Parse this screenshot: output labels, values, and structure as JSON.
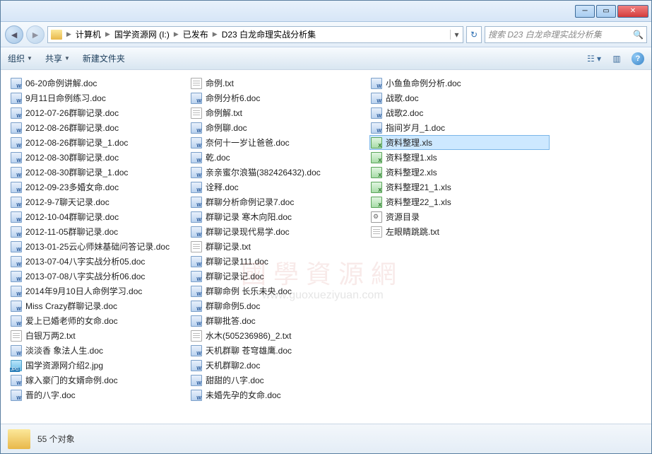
{
  "breadcrumbs": [
    "计算机",
    "国学资源网 (I:)",
    "已发布",
    "D23 白龙命理实战分析集"
  ],
  "search_placeholder": "搜索 D23 白龙命理实战分析集",
  "toolbar": {
    "organize": "组织",
    "share": "共享",
    "newfolder": "新建文件夹"
  },
  "columns": [
    [
      {
        "n": "06-20命例讲解.doc",
        "t": "doc"
      },
      {
        "n": "9月11日命例练习.doc",
        "t": "doc"
      },
      {
        "n": "2012-07-26群聊记录.doc",
        "t": "doc"
      },
      {
        "n": "2012-08-26群聊记录.doc",
        "t": "doc"
      },
      {
        "n": "2012-08-26群聊记录_1.doc",
        "t": "doc"
      },
      {
        "n": "2012-08-30群聊记录.doc",
        "t": "doc"
      },
      {
        "n": "2012-08-30群聊记录_1.doc",
        "t": "doc"
      },
      {
        "n": "2012-09-23多婚女命.doc",
        "t": "doc"
      },
      {
        "n": "2012-9-7聊天记录.doc",
        "t": "doc"
      },
      {
        "n": "2012-10-04群聊记录.doc",
        "t": "doc"
      },
      {
        "n": "2012-11-05群聊记录.doc",
        "t": "doc"
      },
      {
        "n": "2013-01-25云心师妹基础问答记录.doc",
        "t": "doc"
      },
      {
        "n": "2013-07-04八字实战分析05.doc",
        "t": "doc"
      },
      {
        "n": "2013-07-08八字实战分析06.doc",
        "t": "doc"
      },
      {
        "n": "2014年9月10日人命例学习.doc",
        "t": "doc"
      },
      {
        "n": "Miss Crazy群聊记录.doc",
        "t": "doc"
      },
      {
        "n": "爱上已婚老师的女命.doc",
        "t": "doc"
      },
      {
        "n": "白银万两2.txt",
        "t": "txt"
      },
      {
        "n": "淡淡香 象法人生.doc",
        "t": "doc"
      },
      {
        "n": "国学资源网介绍2.jpg",
        "t": "jpg"
      },
      {
        "n": "嫁入豪门的女婿命例.doc",
        "t": "doc"
      },
      {
        "n": "晋的八字.doc",
        "t": "doc"
      }
    ],
    [
      {
        "n": "命例.txt",
        "t": "txt"
      },
      {
        "n": "命例分析6.doc",
        "t": "doc"
      },
      {
        "n": "命例解.txt",
        "t": "txt"
      },
      {
        "n": "命例聊.doc",
        "t": "doc"
      },
      {
        "n": "奈何十一岁让爸爸.doc",
        "t": "doc"
      },
      {
        "n": "乾.doc",
        "t": "doc"
      },
      {
        "n": "亲亲蜜尔浪猫(382426432).doc",
        "t": "doc"
      },
      {
        "n": "诠释.doc",
        "t": "doc"
      },
      {
        "n": "群聊分析命例记录7.doc",
        "t": "doc"
      },
      {
        "n": "群聊记录 寒木向阳.doc",
        "t": "doc"
      },
      {
        "n": "群聊记录现代易学.doc",
        "t": "doc"
      },
      {
        "n": "群聊记录.txt",
        "t": "txt"
      },
      {
        "n": "群聊记录111.doc",
        "t": "doc"
      },
      {
        "n": "群聊记录记.doc",
        "t": "doc"
      },
      {
        "n": "群聊命例 长乐未央.doc",
        "t": "doc"
      },
      {
        "n": "群聊命例5.doc",
        "t": "doc"
      },
      {
        "n": "群聊批答.doc",
        "t": "doc"
      },
      {
        "n": "水木(505236986)_2.txt",
        "t": "txt"
      },
      {
        "n": "天机群聊 苍穹雄鹰.doc",
        "t": "doc"
      },
      {
        "n": "天机群聊2.doc",
        "t": "doc"
      },
      {
        "n": "甜甜的八字.doc",
        "t": "doc"
      },
      {
        "n": "未婚先孕的女命.doc",
        "t": "doc"
      }
    ],
    [
      {
        "n": "小鱼鱼命例分析.doc",
        "t": "doc"
      },
      {
        "n": "战歌.doc",
        "t": "doc"
      },
      {
        "n": "战歌2.doc",
        "t": "doc"
      },
      {
        "n": "指间岁月_1.doc",
        "t": "doc"
      },
      {
        "n": "资料整理.xls",
        "t": "xls",
        "sel": true
      },
      {
        "n": "资料整理1.xls",
        "t": "xls"
      },
      {
        "n": "资料整理2.xls",
        "t": "xls"
      },
      {
        "n": "资料整理21_1.xls",
        "t": "xls"
      },
      {
        "n": "资料整理22_1.xls",
        "t": "xls"
      },
      {
        "n": "资源目录",
        "t": "ini"
      },
      {
        "n": "左眼睛跳跳.txt",
        "t": "txt"
      }
    ]
  ],
  "status": "55 个对象",
  "watermark_main": "國學資源網",
  "watermark_url": "www.guoxueziyuan.com"
}
